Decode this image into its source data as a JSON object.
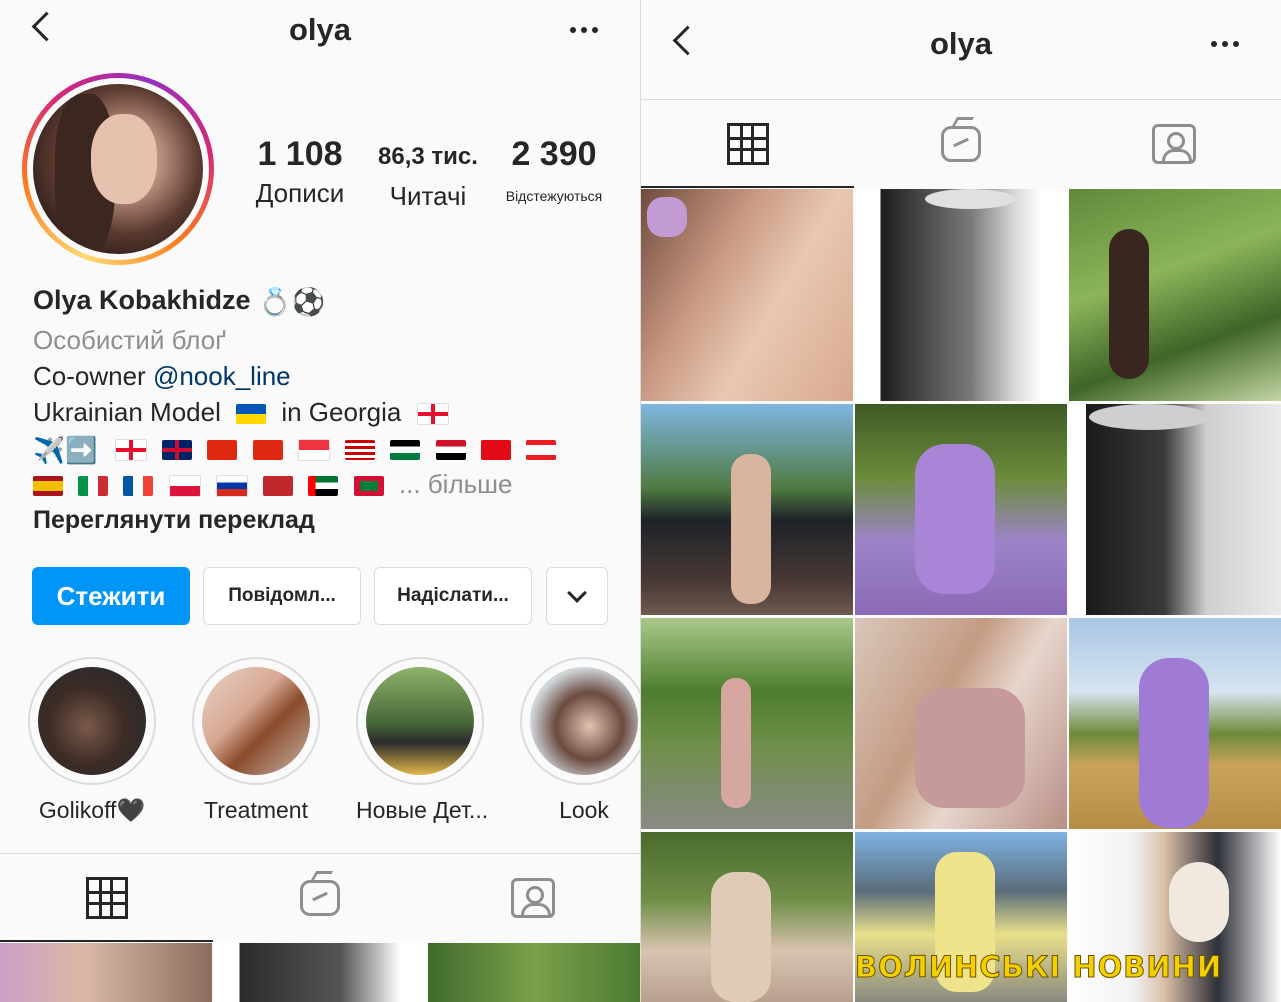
{
  "left": {
    "header": {
      "title": "olya"
    },
    "stats": [
      {
        "value": "1 108",
        "label": "Дописи"
      },
      {
        "value": "86,3 тис.",
        "label": "Читачі"
      },
      {
        "value": "2 390",
        "label": "Відстежуються"
      }
    ],
    "bio": {
      "name": "Olya Kobakhidze",
      "name_emoji": "💍⚽",
      "category": "Особистий блоґ",
      "line1_prefix": "Co-owner ",
      "line1_mention": "@nook_line",
      "line2_a": "Ukrainian Model",
      "line2_b": "in Georgia",
      "travel_emoji": "✈️➡️",
      "more": "... більше",
      "translate": "Переглянути переклад"
    },
    "buttons": {
      "follow": "Стежити",
      "message": "Повідомл...",
      "send": "Надіслати..."
    },
    "highlights": [
      {
        "label": "Golikoff🖤"
      },
      {
        "label": "Treatment"
      },
      {
        "label": "Новые Дет..."
      },
      {
        "label": "Look"
      }
    ]
  },
  "right": {
    "header": {
      "title": "olya"
    },
    "watermark": "ВОЛИНСЬКІ НОВИНИ"
  },
  "colors": {
    "accent": "#0095f6",
    "mention": "#00376b",
    "muted": "#8e8e8e",
    "border": "#dbdbdb",
    "watermark": "#f5d000"
  },
  "icons": [
    "back-icon",
    "more-icon",
    "grid-icon",
    "igtv-icon",
    "tagged-icon",
    "chevron-down-icon"
  ]
}
